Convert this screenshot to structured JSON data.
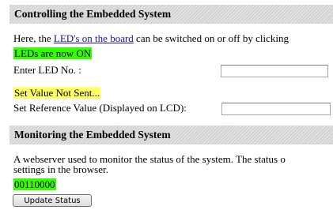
{
  "control_section": {
    "title": "Controlling the Embedded System",
    "intro_prefix": "Here, the ",
    "intro_link": "LED's on the board",
    "intro_suffix": " can be switched on or off by clicking",
    "led_status": "LEDs are now ON",
    "led_label": "Enter LED No. :",
    "led_value": "",
    "set_status": "Set Value Not Sent...",
    "ref_label": "Set Reference Value (Displayed on LCD):",
    "ref_value": ""
  },
  "monitor_section": {
    "title": "Monitoring the Embedded System",
    "desc_line1": "A webserver used to monitor the status of the system. The status o",
    "desc_line2": "settings in the browser.",
    "status_value": "00110000",
    "update_button": "Update Status"
  },
  "colors": {
    "header_bg": "#d3d3d3",
    "highlight_green": "#33ff00",
    "highlight_yellow": "#ffff66",
    "link": "#1a0dab"
  }
}
